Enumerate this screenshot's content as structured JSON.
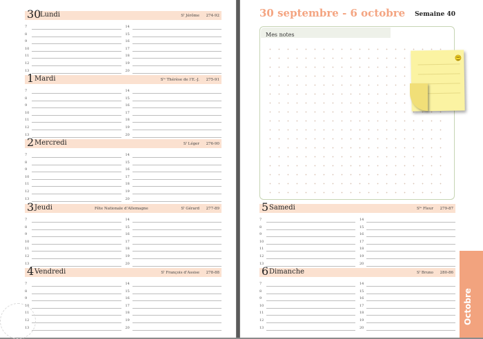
{
  "week_title": "30 septembre - 6 octobre",
  "week_number": "Semaine 40",
  "notes_label": "Mes notes",
  "month_tab": "Octobre",
  "hours_left": [
    "7",
    "8",
    "9",
    "10",
    "11",
    "12",
    "13"
  ],
  "hours_right": [
    "14",
    "15",
    "16",
    "17",
    "18",
    "19",
    "20"
  ],
  "left_days": [
    {
      "num": "30",
      "name": "Lundi",
      "holiday": "",
      "saint": "Sᵗ Jérôme",
      "dayno": "274-92"
    },
    {
      "num": "1",
      "name": "Mardi",
      "holiday": "",
      "saint": "Sᵗᵉ Thérèse de l’E.-J.",
      "dayno": "275-91"
    },
    {
      "num": "2",
      "name": "Mercredi",
      "holiday": "",
      "saint": "Sᵗ Léger",
      "dayno": "276-90"
    },
    {
      "num": "3",
      "name": "Jeudi",
      "holiday": "Fête Nationale d’Allemagne",
      "saint": "Sᵗ Gérard",
      "dayno": "277-89"
    },
    {
      "num": "4",
      "name": "Vendredi",
      "holiday": "",
      "saint": "Sᵗ François d’Assise",
      "dayno": "278-88"
    }
  ],
  "right_days": [
    {
      "num": "5",
      "name": "Samedi",
      "holiday": "",
      "saint": "Sᵗᵉ Fleur",
      "dayno": "279-87"
    },
    {
      "num": "6",
      "name": "Dimanche",
      "holiday": "",
      "saint": "Sᵗ Bruno",
      "dayno": "280-86"
    }
  ],
  "colors": {
    "header_band": "#fbe1d0",
    "title": "#f4a582",
    "tab": "#f2a37e",
    "notes_border": "#c6d4b3",
    "sticky": "#fbf3a2"
  }
}
